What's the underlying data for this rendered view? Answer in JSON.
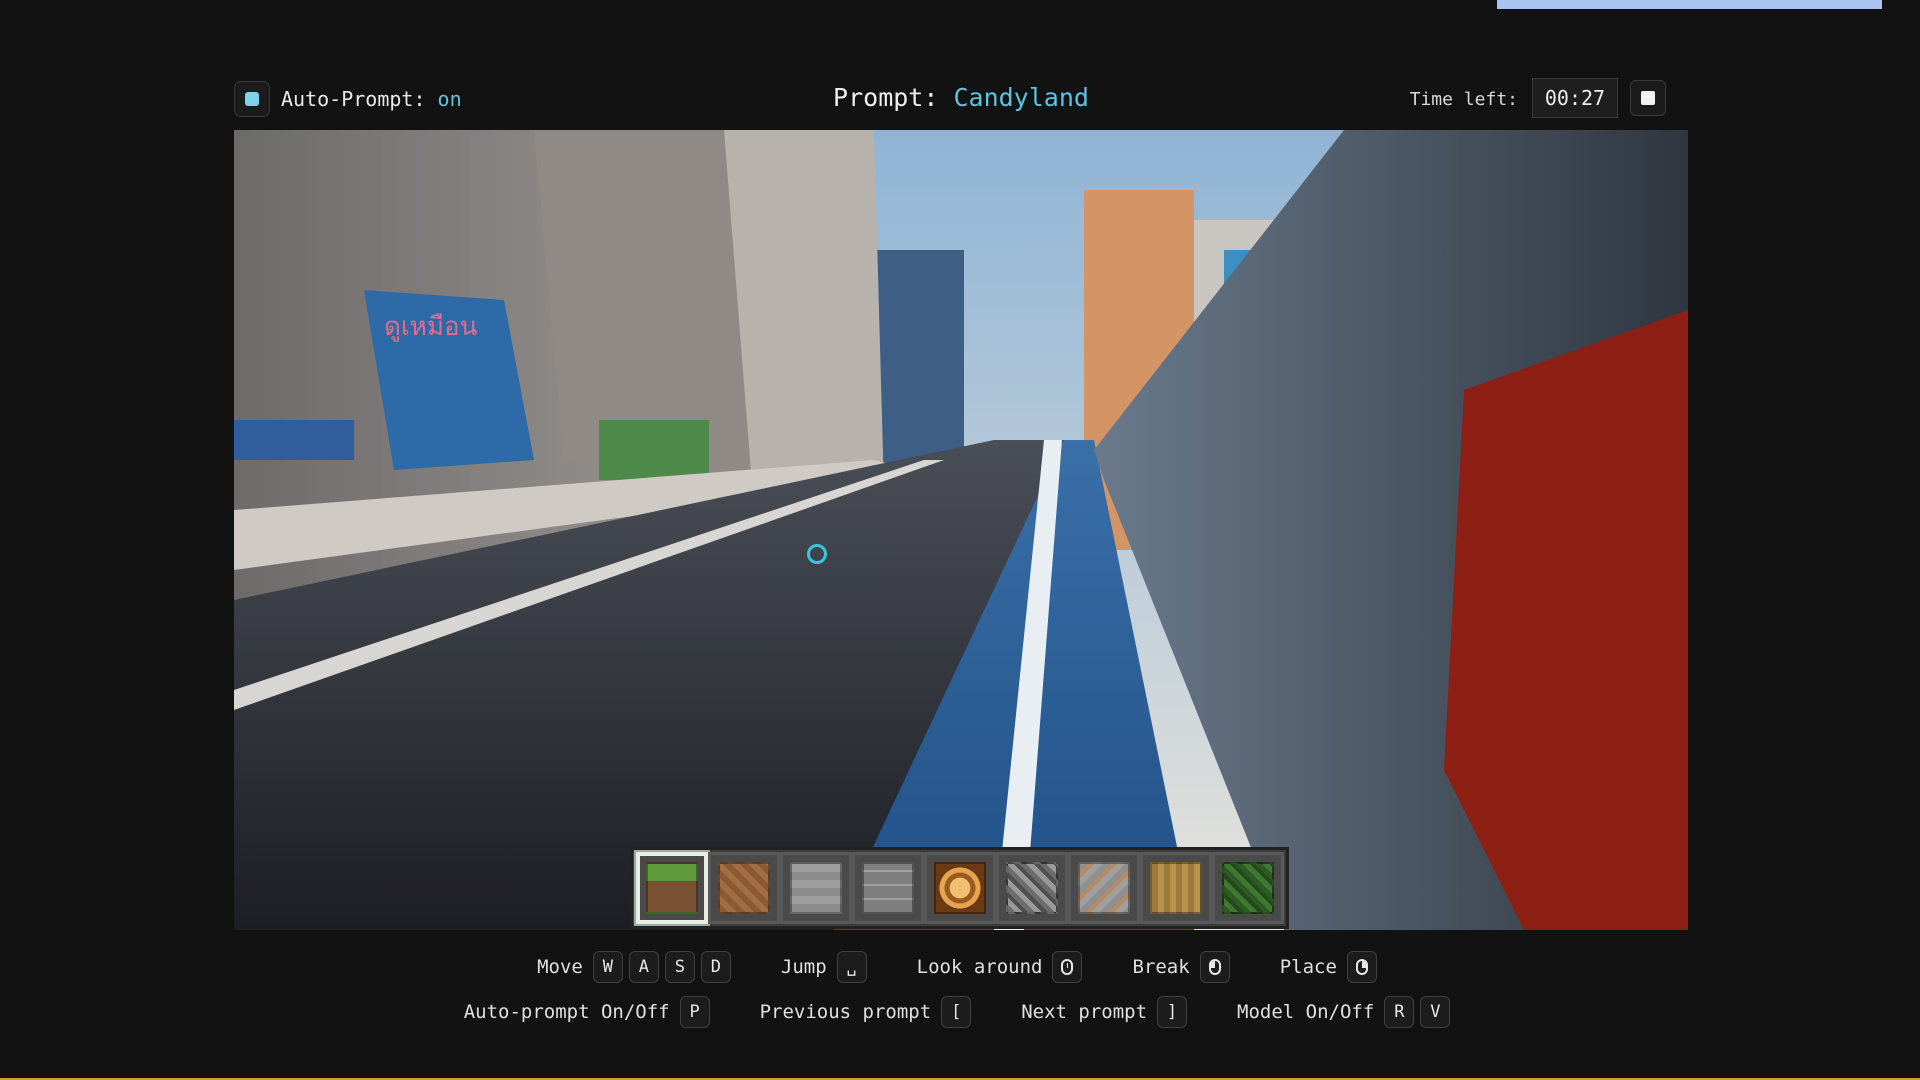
{
  "header": {
    "auto_prompt_label": "Auto-Prompt:",
    "auto_prompt_value": "on",
    "prompt_label": "Prompt:",
    "prompt_value": "Candyland",
    "time_label": "Time left:",
    "time_value": "00:27"
  },
  "game": {
    "crosshair_icon": "crosshair-ring-icon",
    "storefront_sign_text": "ดูเหมือน",
    "hotbar": {
      "selected_index": 0,
      "slots": [
        "grass-block",
        "dirt-block",
        "stone-block",
        "stone-brick-block",
        "glowstone-block",
        "gravel-block",
        "ore-block",
        "wood-block",
        "leaves-block"
      ]
    }
  },
  "controls": {
    "move_label": "Move",
    "move_keys": [
      "W",
      "A",
      "S",
      "D"
    ],
    "jump_label": "Jump",
    "jump_key": "␣",
    "look_label": "Look around",
    "break_label": "Break",
    "place_label": "Place",
    "autoprompt_label": "Auto-prompt On/Off",
    "autoprompt_key": "P",
    "prev_label": "Previous prompt",
    "prev_key": "[",
    "next_label": "Next prompt",
    "next_key": "]",
    "model_label": "Model On/Off",
    "model_keys": [
      "R",
      "V"
    ]
  },
  "colors": {
    "accent": "#5fc4e0",
    "background": "#121212",
    "top_progress": "#a9c4ee"
  }
}
